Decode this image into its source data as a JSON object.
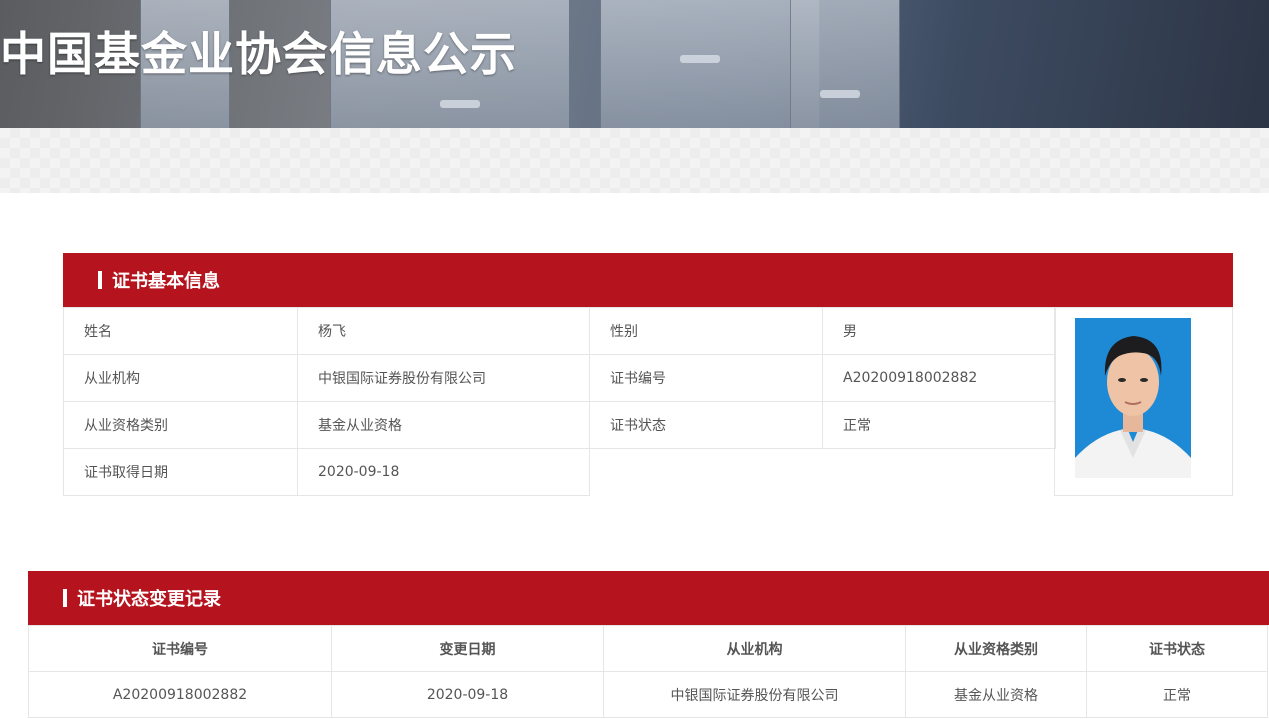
{
  "banner": {
    "title": "中国基金业协会信息公示"
  },
  "basic_info": {
    "section_title": "证书基本信息",
    "rows": [
      [
        {
          "label": "姓名",
          "value": "杨飞"
        },
        {
          "label": "性别",
          "value": "男"
        }
      ],
      [
        {
          "label": "从业机构",
          "value": "中银国际证券股份有限公司"
        },
        {
          "label": "证书编号",
          "value": "A20200918002882"
        }
      ],
      [
        {
          "label": "从业资格类别",
          "value": "基金从业资格"
        },
        {
          "label": "证书状态",
          "value": "正常"
        }
      ],
      [
        {
          "label": "证书取得日期",
          "value": "2020-09-18"
        }
      ]
    ]
  },
  "status_changes": {
    "section_title": "证书状态变更记录",
    "columns": [
      "证书编号",
      "变更日期",
      "从业机构",
      "从业资格类别",
      "证书状态"
    ],
    "rows": [
      [
        "A20200918002882",
        "2020-09-18",
        "中银国际证券股份有限公司",
        "基金从业资格",
        "正常"
      ]
    ]
  },
  "colors": {
    "accent": "#b5141e",
    "photo_bg": "#1e8ad6",
    "border": "#e6e6e6"
  }
}
